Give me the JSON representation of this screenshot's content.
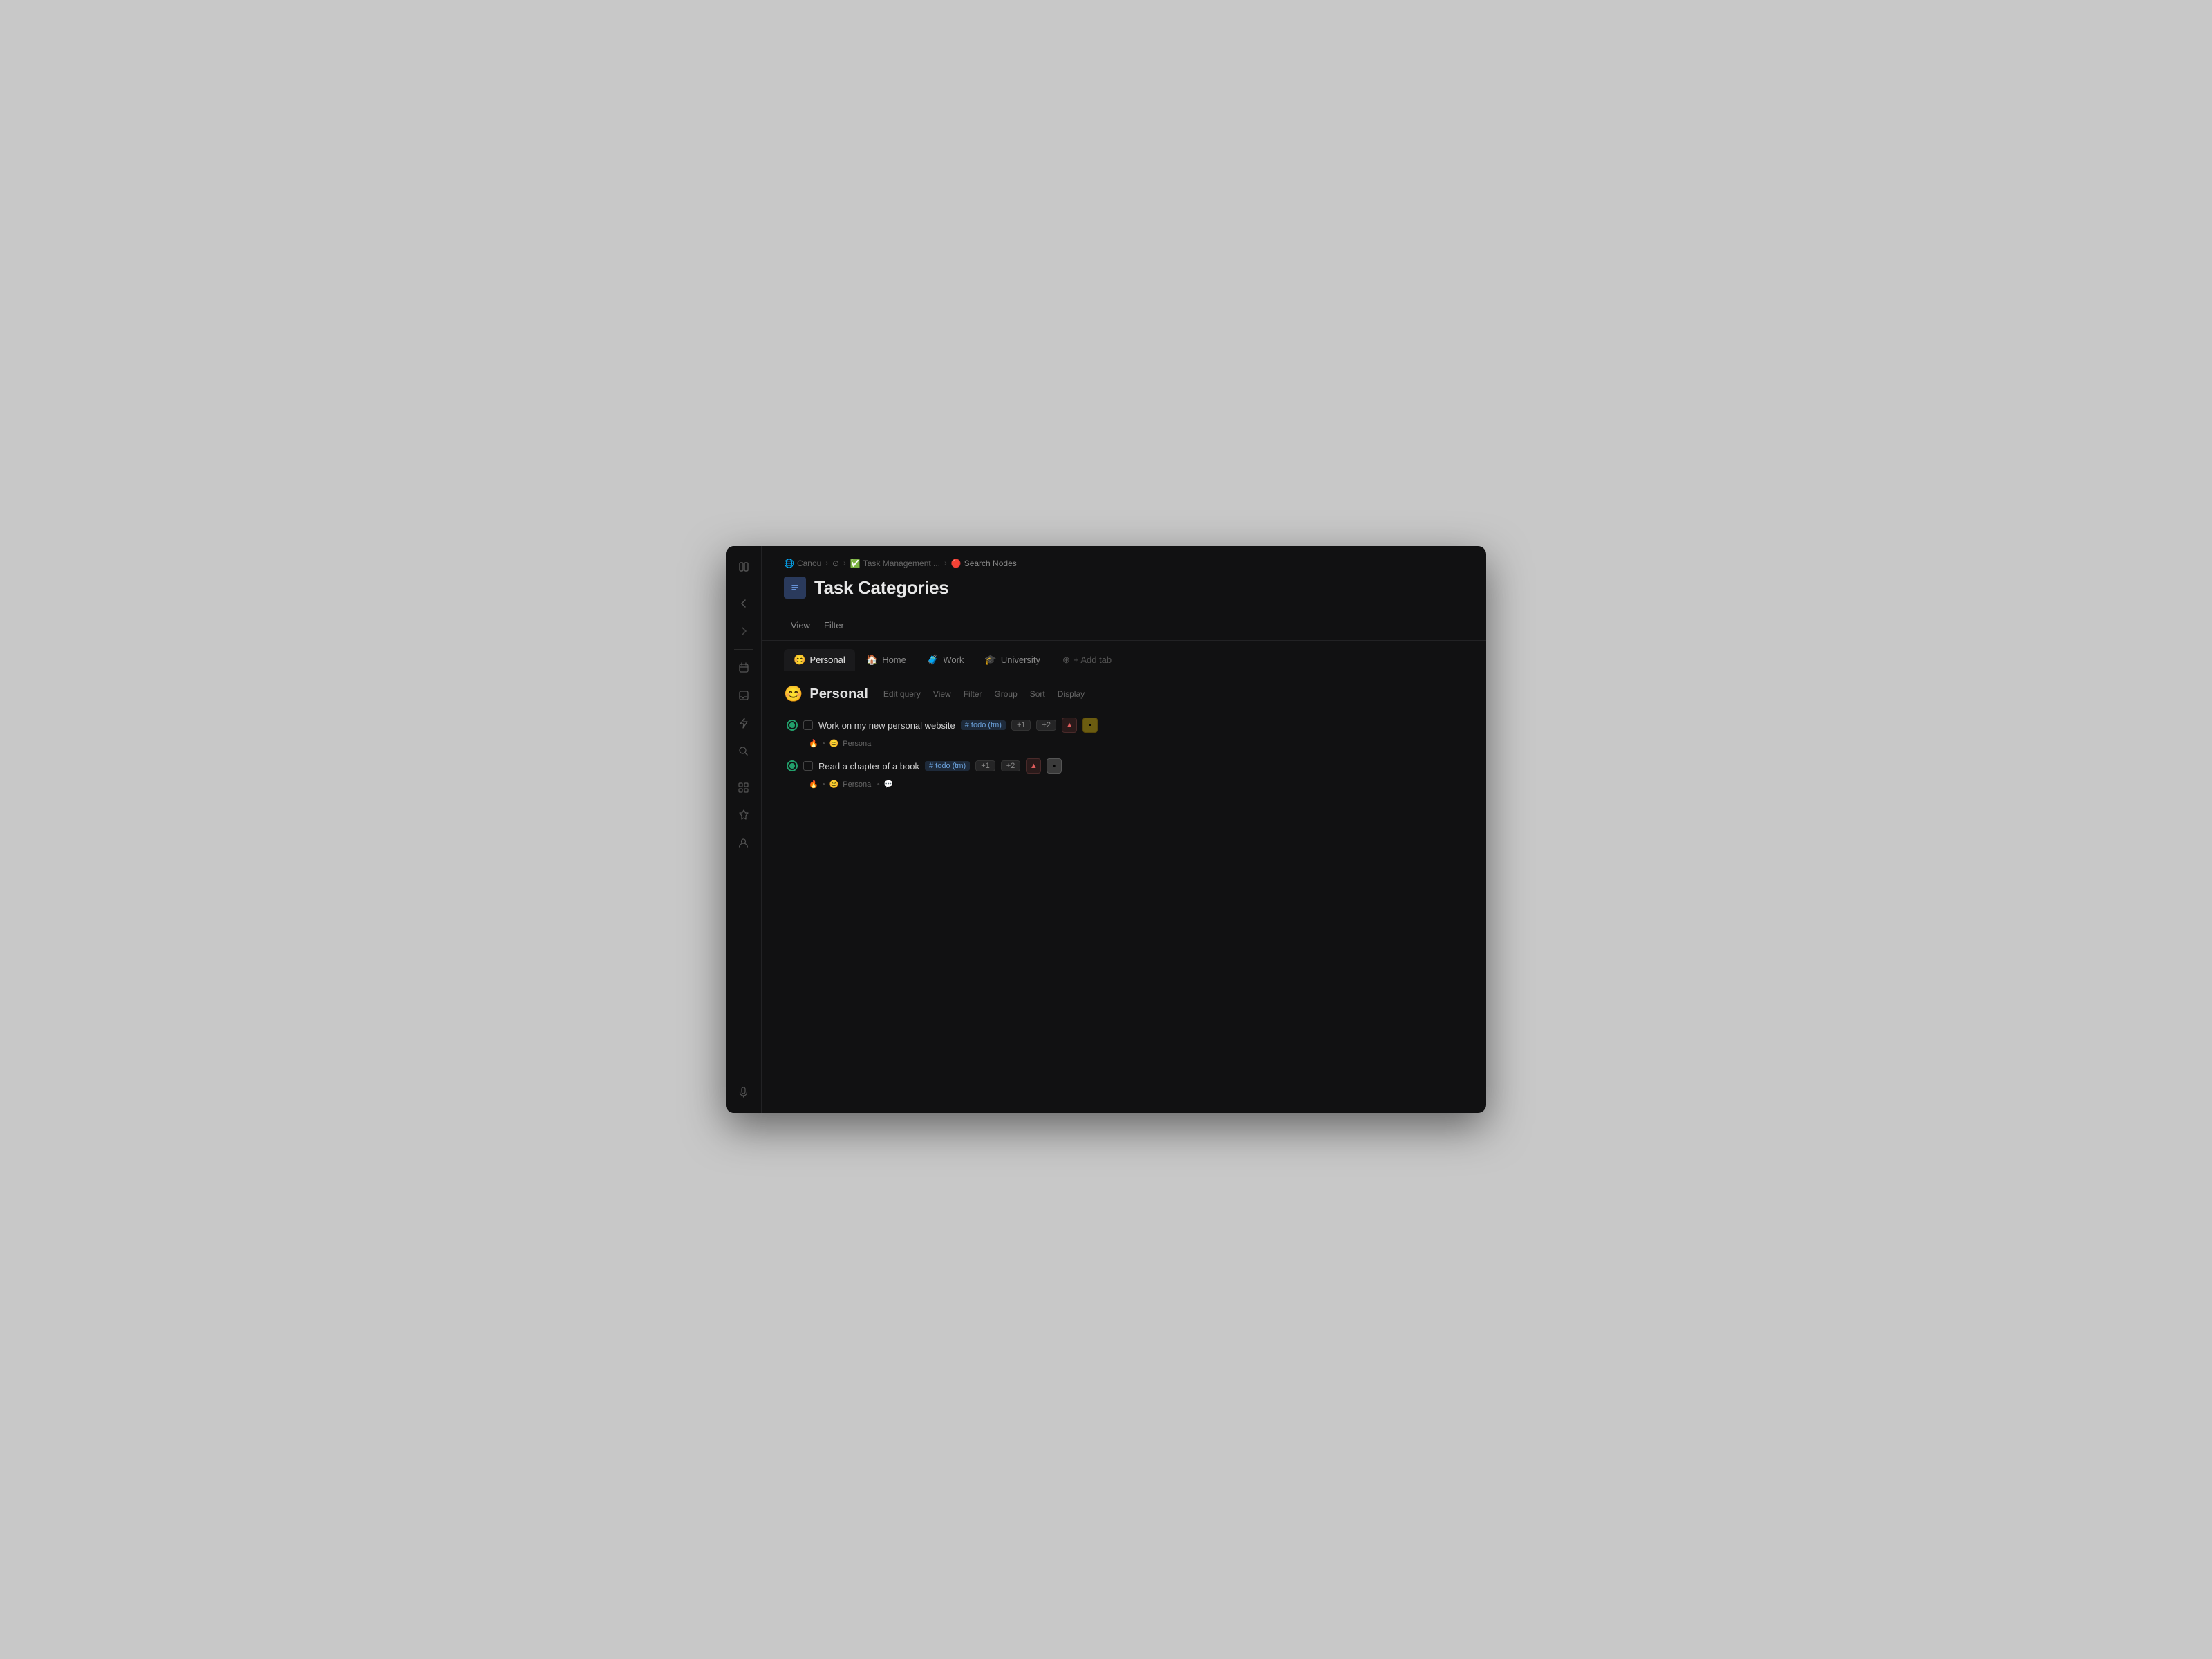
{
  "window": {
    "title": "Task Categories"
  },
  "sidebar": {
    "icons": [
      {
        "name": "collapse-icon",
        "symbol": "⊟"
      },
      {
        "name": "back-icon",
        "symbol": "←"
      },
      {
        "name": "forward-icon",
        "symbol": "→"
      },
      {
        "name": "calendar-icon",
        "symbol": "▦"
      },
      {
        "name": "inbox-icon",
        "symbol": "⊡"
      },
      {
        "name": "bolt-icon",
        "symbol": "⚡"
      },
      {
        "name": "search-icon",
        "symbol": "⌕"
      },
      {
        "name": "grid-icon",
        "symbol": "⊞"
      },
      {
        "name": "pin-icon",
        "symbol": "📌"
      },
      {
        "name": "avatar-icon",
        "symbol": "👤"
      },
      {
        "name": "mic-icon",
        "symbol": "🎤"
      }
    ]
  },
  "breadcrumb": {
    "items": [
      {
        "label": "Canou",
        "icon": "🌐"
      },
      {
        "label": "...",
        "icon": ""
      },
      {
        "label": "Task Management ...",
        "icon": "✅"
      },
      {
        "label": "Search Nodes",
        "icon": "🔴"
      }
    ],
    "separators": [
      ">",
      ">",
      ">"
    ]
  },
  "page": {
    "icon": "≡",
    "title": "Task Categories"
  },
  "toolbar": {
    "view_label": "View",
    "filter_label": "Filter"
  },
  "tabs": [
    {
      "id": "personal",
      "label": "Personal",
      "icon": "😊",
      "active": true
    },
    {
      "id": "home",
      "label": "Home",
      "icon": "🏠",
      "active": false
    },
    {
      "id": "work",
      "label": "Work",
      "icon": "🧳",
      "active": false
    },
    {
      "id": "university",
      "label": "University",
      "icon": "🎓",
      "active": false
    }
  ],
  "add_tab_label": "+ Add tab",
  "group": {
    "emoji": "😊",
    "title": "Personal",
    "actions": [
      "Edit query",
      "View",
      "Filter",
      "Group",
      "Sort",
      "Display"
    ]
  },
  "tasks": [
    {
      "id": 1,
      "name": "Work on my new personal website",
      "tag": "# todo (tm)",
      "badges": [
        "+1",
        "+2"
      ],
      "has_priority_high": true,
      "has_square": true,
      "square_color": "yellow",
      "meta_fire": "🔥",
      "meta_dot": "•",
      "meta_emoji": "😊",
      "meta_label": "Personal"
    },
    {
      "id": 2,
      "name": "Read a chapter of a book",
      "tag": "# todo (tm)",
      "badges": [
        "+1",
        "+2"
      ],
      "has_priority_high": true,
      "has_square": true,
      "square_color": "gray",
      "meta_fire": "🔥",
      "meta_dot": "•",
      "meta_emoji": "😊",
      "meta_label": "Personal",
      "meta_dot2": "•",
      "meta_extra": "💬"
    }
  ]
}
